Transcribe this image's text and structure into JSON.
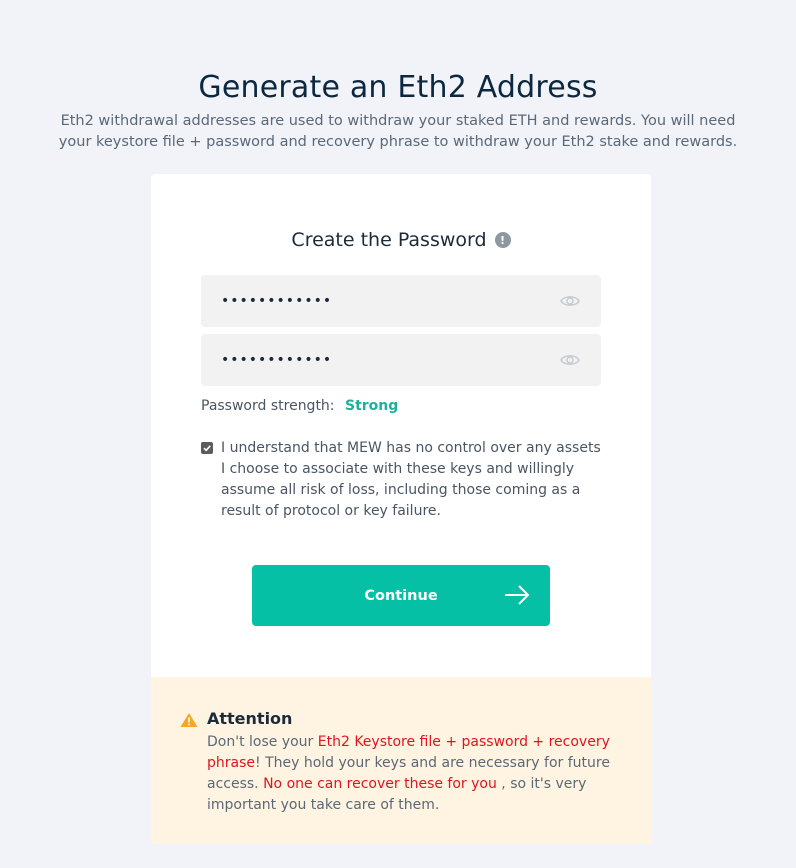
{
  "header": {
    "title": "Generate an Eth2 Address",
    "subtitle": "Eth2 withdrawal addresses are used to withdraw your staked ETH and rewards. You will need your keystore file + password and recovery phrase to withdraw your Eth2 stake and rewards."
  },
  "password_card": {
    "title": "Create the Password",
    "info_icon": "info-icon",
    "password_field": {
      "value": "••••••••••••",
      "icon": "eye-icon"
    },
    "confirm_field": {
      "value": "••••••••••••",
      "icon": "eye-icon"
    },
    "strength_label": "Password strength:",
    "strength_value": "Strong",
    "terms_checked": true,
    "terms_text": "I understand that MEW has no control over any assets I choose to associate with these keys and willingly assume all risk of loss, including those coming as a result of protocol or key failure.",
    "continue_label": "Continue"
  },
  "attention": {
    "title": "Attention",
    "body_part1": "Don't lose your ",
    "body_highlight1": "Eth2 Keystore file + password + recovery phrase",
    "body_part2": "! They hold your keys and are necessary for future access. ",
    "body_highlight2": "No one can recover these for you",
    "body_part3": " , so it's very important you take care of them."
  },
  "colors": {
    "accent": "#05c0a5",
    "strength": "#1eb19b",
    "warning": "#e0141e",
    "attention_bg": "#fff4e2",
    "page_bg": "#f2f3f8"
  }
}
